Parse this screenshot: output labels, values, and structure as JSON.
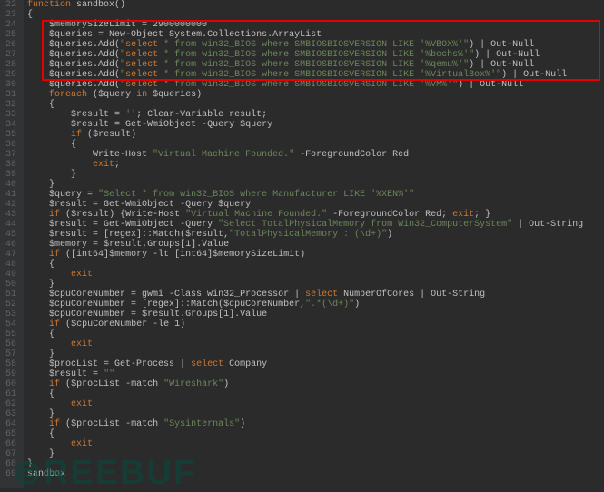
{
  "lines": [
    {
      "num": 22,
      "indent": 0,
      "text": "function sandbox()"
    },
    {
      "num": 23,
      "indent": 0,
      "text": "{"
    },
    {
      "num": 24,
      "indent": 1,
      "text": "$memorySizeLimit = 2900000000"
    },
    {
      "num": 25,
      "indent": 1,
      "text": "$queries = New-Object System.Collections.ArrayList"
    },
    {
      "num": 26,
      "indent": 1,
      "text": "$queries.Add(\"select * from win32_BIOS where SMBIOSBIOSVERSION LIKE '%VBOX%'\") | Out-Null"
    },
    {
      "num": 27,
      "indent": 1,
      "text": "$queries.Add(\"select * from win32_BIOS where SMBIOSBIOSVERSION LIKE '%bochs%'\") | Out-Null"
    },
    {
      "num": 28,
      "indent": 1,
      "text": "$queries.Add(\"select * from win32_BIOS where SMBIOSBIOSVERSION LIKE '%qemu%'\") | Out-Null"
    },
    {
      "num": 29,
      "indent": 1,
      "text": "$queries.Add(\"select * from win32_BIOS where SMBIOSBIOSVERSION LIKE '%VirtualBox%'\") | Out-Null"
    },
    {
      "num": 30,
      "indent": 1,
      "text": "$queries.Add(\"select * from win32_BIOS where SMBIOSBIOSVERSION LIKE '%VM%'\") | Out-Null"
    },
    {
      "num": 31,
      "indent": 1,
      "text": "foreach ($query in $queries)"
    },
    {
      "num": 32,
      "indent": 1,
      "text": "{"
    },
    {
      "num": 33,
      "indent": 2,
      "text": "$result = ''; Clear-Variable result;"
    },
    {
      "num": 34,
      "indent": 2,
      "text": "$result = Get-WmiObject -Query $query"
    },
    {
      "num": 35,
      "indent": 2,
      "text": "if ($result)"
    },
    {
      "num": 36,
      "indent": 2,
      "text": "{"
    },
    {
      "num": 37,
      "indent": 3,
      "text": "Write-Host \"Virtual Machine Founded.\" -ForegroundColor Red"
    },
    {
      "num": 38,
      "indent": 3,
      "text": "exit;"
    },
    {
      "num": 39,
      "indent": 2,
      "text": "}"
    },
    {
      "num": 40,
      "indent": 1,
      "text": "}"
    },
    {
      "num": 41,
      "indent": 1,
      "text": "$query = \"Select * from win32_BIOS where Manufacturer LIKE '%XEN%'\""
    },
    {
      "num": 42,
      "indent": 1,
      "text": "$result = Get-WmiObject -Query $query"
    },
    {
      "num": 43,
      "indent": 1,
      "text": "if ($result) {Write-Host \"Virtual Machine Founded.\" -ForegroundColor Red; exit; }"
    },
    {
      "num": 44,
      "indent": 1,
      "text": "$result = Get-WmiObject -Query \"Select TotalPhysicalMemory from Win32_ComputerSystem\" | Out-String"
    },
    {
      "num": 45,
      "indent": 1,
      "text": "$result = [regex]::Match($result,\"TotalPhysicalMemory : (\\d+)\")"
    },
    {
      "num": 46,
      "indent": 1,
      "text": "$memory = $result.Groups[1].Value"
    },
    {
      "num": 47,
      "indent": 1,
      "text": "if ([int64]$memory -lt [int64]$memorySizeLimit)"
    },
    {
      "num": 48,
      "indent": 1,
      "text": "{"
    },
    {
      "num": 49,
      "indent": 2,
      "text": "exit"
    },
    {
      "num": 50,
      "indent": 1,
      "text": "}"
    },
    {
      "num": 51,
      "indent": 1,
      "text": "$cpuCoreNumber = gwmi -Class win32_Processor | select NumberOfCores | Out-String"
    },
    {
      "num": 52,
      "indent": 1,
      "text": "$cpuCoreNumber = [regex]::Match($cpuCoreNumber,\".*(\\d+)\")"
    },
    {
      "num": 53,
      "indent": 1,
      "text": "$cpuCoreNumber = $result.Groups[1].Value"
    },
    {
      "num": 54,
      "indent": 1,
      "text": "if ($cpuCoreNumber -le 1)"
    },
    {
      "num": 55,
      "indent": 1,
      "text": "{"
    },
    {
      "num": 56,
      "indent": 2,
      "text": "exit"
    },
    {
      "num": 57,
      "indent": 1,
      "text": "}"
    },
    {
      "num": 58,
      "indent": 1,
      "text": "$procList = Get-Process | select Company"
    },
    {
      "num": 59,
      "indent": 1,
      "text": "$result = \"\""
    },
    {
      "num": 60,
      "indent": 1,
      "text": "if ($procList -match \"Wireshark\")"
    },
    {
      "num": 61,
      "indent": 1,
      "text": "{"
    },
    {
      "num": 62,
      "indent": 2,
      "text": "exit"
    },
    {
      "num": 63,
      "indent": 1,
      "text": "}"
    },
    {
      "num": 64,
      "indent": 1,
      "text": "if ($procList -match \"Sysinternals\")"
    },
    {
      "num": 65,
      "indent": 1,
      "text": "{"
    },
    {
      "num": 66,
      "indent": 2,
      "text": "exit"
    },
    {
      "num": 67,
      "indent": 1,
      "text": "}"
    },
    {
      "num": 68,
      "indent": 0,
      "text": "}"
    },
    {
      "num": 69,
      "indent": 0,
      "text": "sandbox"
    }
  ],
  "watermark": "REEBUF"
}
